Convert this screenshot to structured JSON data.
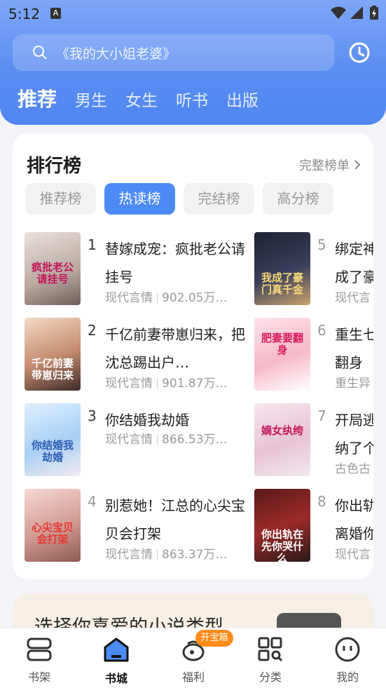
{
  "status": {
    "time": "5:12",
    "a_icon": "A"
  },
  "search": {
    "placeholder": "《我的大小姐老婆》"
  },
  "tabs": [
    {
      "label": "推荐",
      "active": true
    },
    {
      "label": "男生"
    },
    {
      "label": "女生"
    },
    {
      "label": "听书"
    },
    {
      "label": "出版"
    }
  ],
  "ranking": {
    "title": "排行榜",
    "more": "完整榜单",
    "chips": [
      "推荐榜",
      "热读榜",
      "完结榜",
      "高分榜"
    ],
    "active_chip": "热读榜",
    "items": [
      {
        "rank": "1",
        "title": "替嫁成宠：疯批老公请挂号",
        "cover_title": "疯批老公请挂号",
        "category": "现代言情",
        "count": "902.05万…"
      },
      {
        "rank": "2",
        "title": "千亿前妻带崽归来，把沈总踢出户…",
        "cover_title": "千亿前妻带崽归来",
        "category": "现代言情",
        "count": "901.87万…"
      },
      {
        "rank": "3",
        "title": "你结婚我劫婚",
        "cover_title": "你结婚我劫婚",
        "category": "现代言情",
        "count": "866.53万…"
      },
      {
        "rank": "4",
        "title": "别惹她！江总的心尖宝贝会打架",
        "cover_title": "心尖宝贝会打架",
        "category": "现代言情",
        "count": "863.37万…"
      },
      {
        "rank": "5",
        "title": "绑定神豪系统成了豪门",
        "cover_title": "我成了豪门真千金",
        "category": "现代言",
        "count": ""
      },
      {
        "rank": "6",
        "title": "重生七零肥妻翻身",
        "cover_title": "肥妻要翻身",
        "category": "重生异",
        "count": ""
      },
      {
        "rank": "7",
        "title": "开局逃婚，我纳了个纨绔",
        "cover_title": "嫡女纨绔",
        "category": "古色古",
        "count": ""
      },
      {
        "rank": "8",
        "title": "你出轨在先，离婚你哭什么",
        "cover_title": "你出轨在先你哭什么",
        "category": "现代言",
        "count": ""
      }
    ]
  },
  "genre": {
    "title": "选择你喜爱的小说类型"
  },
  "bottom_nav": [
    {
      "label": "书架",
      "icon": "bookshelf-icon"
    },
    {
      "label": "书城",
      "icon": "bookstore-icon",
      "active": true
    },
    {
      "label": "福利",
      "icon": "gift-bag-icon"
    },
    {
      "label": "分类",
      "icon": "category-icon"
    },
    {
      "label": "我的",
      "icon": "profile-icon"
    }
  ],
  "badge": "开宝箱",
  "colors": {
    "accent": "#4c8bf5",
    "header": "#5c8ef2",
    "badge": "#ff8c1a"
  }
}
